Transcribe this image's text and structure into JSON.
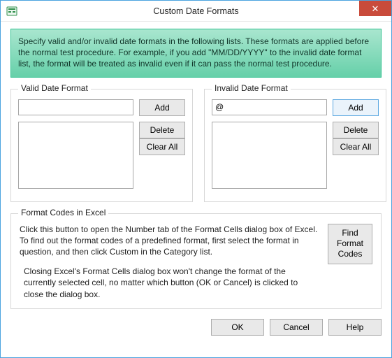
{
  "window": {
    "title": "Custom Date Formats",
    "close_symbol": "✕"
  },
  "banner": {
    "text": "Specify valid and/or invalid date formats in the following lists. These formats are applied before the normal test procedure. For example, if you add \"MM/DD/YYYY\" to the invalid date format list, the format will be treated as invalid even if it can pass the normal test procedure."
  },
  "valid": {
    "title": "Valid Date Format",
    "input_value": "",
    "add_label": "Add",
    "delete_label": "Delete",
    "clear_label": "Clear All"
  },
  "invalid": {
    "title": "Invalid Date Format",
    "input_value": "@",
    "add_label": "Add",
    "delete_label": "Delete",
    "clear_label": "Clear All"
  },
  "codes": {
    "title": "Format Codes in Excel",
    "p1": "Click this button to open the Number tab of the Format Cells dialog box of Excel. To find out the format codes of a predefined format, first select the format in question, and then click Custom in the Category list.",
    "p2": "Closing Excel's Format Cells dialog box won't change the format of the currently selected cell, no matter which button (OK or Cancel) is clicked to close the dialog box.",
    "find_label": "Find Format Codes"
  },
  "footer": {
    "ok": "OK",
    "cancel": "Cancel",
    "help": "Help"
  }
}
